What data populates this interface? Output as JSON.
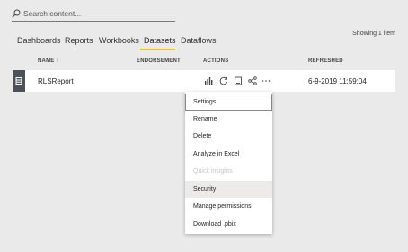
{
  "search": {
    "placeholder": "Search content..."
  },
  "tabs": [
    {
      "label": "Dashboards"
    },
    {
      "label": "Reports"
    },
    {
      "label": "Workbooks"
    },
    {
      "label": "Datasets"
    },
    {
      "label": "Dataflows"
    }
  ],
  "active_tab": "Datasets",
  "accent_color": "#f2c811",
  "showing_text": "Showing 1 item",
  "table": {
    "headers": {
      "name": "NAME ↑",
      "endorsement": "ENDORSEMENT",
      "actions": "ACTIONS",
      "refreshed": "REFRESHED"
    },
    "rows": [
      {
        "type_icon": "dataset-icon",
        "name": "RLSReport",
        "refreshed": "6-9-2019 11:59:04",
        "actions": [
          "create-report-icon",
          "refresh-icon",
          "schedule-refresh-icon",
          "share-icon",
          "more-options-icon"
        ]
      }
    ]
  },
  "context_menu": {
    "items": [
      {
        "label": "Settings",
        "state": "focused"
      },
      {
        "label": "Rename",
        "state": "normal"
      },
      {
        "label": "Delete",
        "state": "normal"
      },
      {
        "label": "Analyze in Excel",
        "state": "normal"
      },
      {
        "label": "Quick insights",
        "state": "disabled"
      },
      {
        "label": "Security",
        "state": "hover"
      },
      {
        "label": "Manage permissions",
        "state": "normal"
      },
      {
        "label": "Download .pbix",
        "state": "normal"
      }
    ]
  }
}
